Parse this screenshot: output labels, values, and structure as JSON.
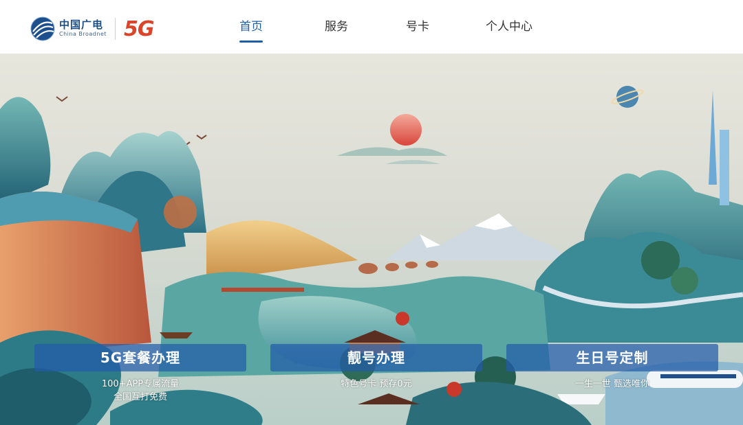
{
  "brand": {
    "name_cn": "中国广电",
    "name_en": "China Broadnet",
    "badge": "5G",
    "icon": "broadnet-globe-icon"
  },
  "nav": {
    "items": [
      {
        "label": "首页",
        "active": true
      },
      {
        "label": "服务",
        "active": false
      },
      {
        "label": "号卡",
        "active": false
      },
      {
        "label": "个人中心",
        "active": false
      }
    ],
    "active_color": "#1d5ea8"
  },
  "banner": {
    "illustration": "guochao-landscape-illustration",
    "cards": [
      {
        "title": "5G套餐办理",
        "lines": [
          "100+APP专属流量",
          "全国互打免费"
        ]
      },
      {
        "title": "靓号办理",
        "lines": [
          "特色号卡 预存0元"
        ]
      },
      {
        "title": "生日号定制",
        "lines": [
          "一生一世 甄选唯你"
        ]
      }
    ],
    "card_color": "#235caa"
  }
}
